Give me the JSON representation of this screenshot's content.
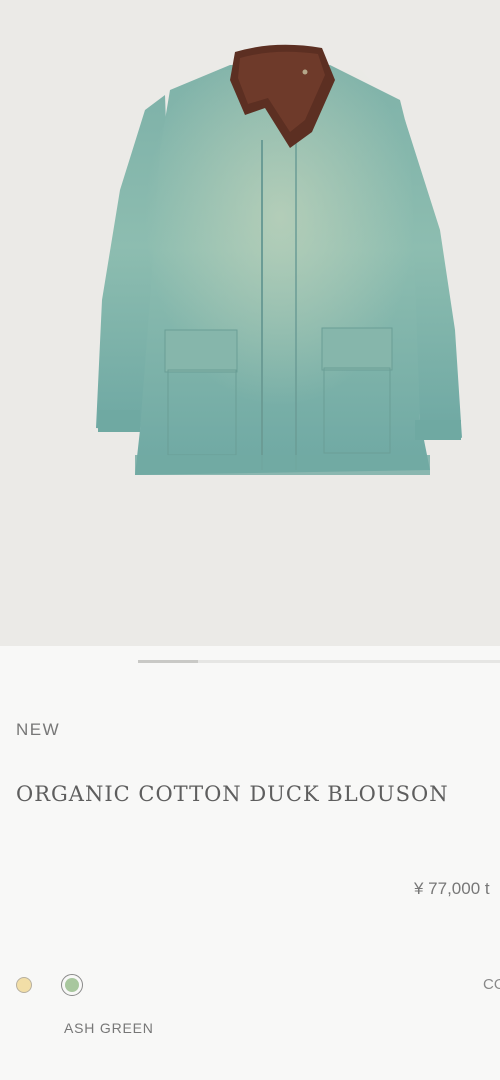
{
  "hero": {
    "image_subject": "jacket-photo",
    "background_color": "#ebeae7"
  },
  "carousel": {
    "current_index": 1,
    "total": 6
  },
  "product": {
    "badge": "NEW",
    "name": "ORGANIC COTTON DUCK BLOUSON",
    "price": "¥ 77,000 t"
  },
  "colors": {
    "swatches": [
      {
        "color": "#f2dea7",
        "selected": false
      },
      {
        "color": "#a8c79e",
        "selected": true
      }
    ],
    "selected_label": "ASH GREEN",
    "right_cut_text": "CO"
  }
}
